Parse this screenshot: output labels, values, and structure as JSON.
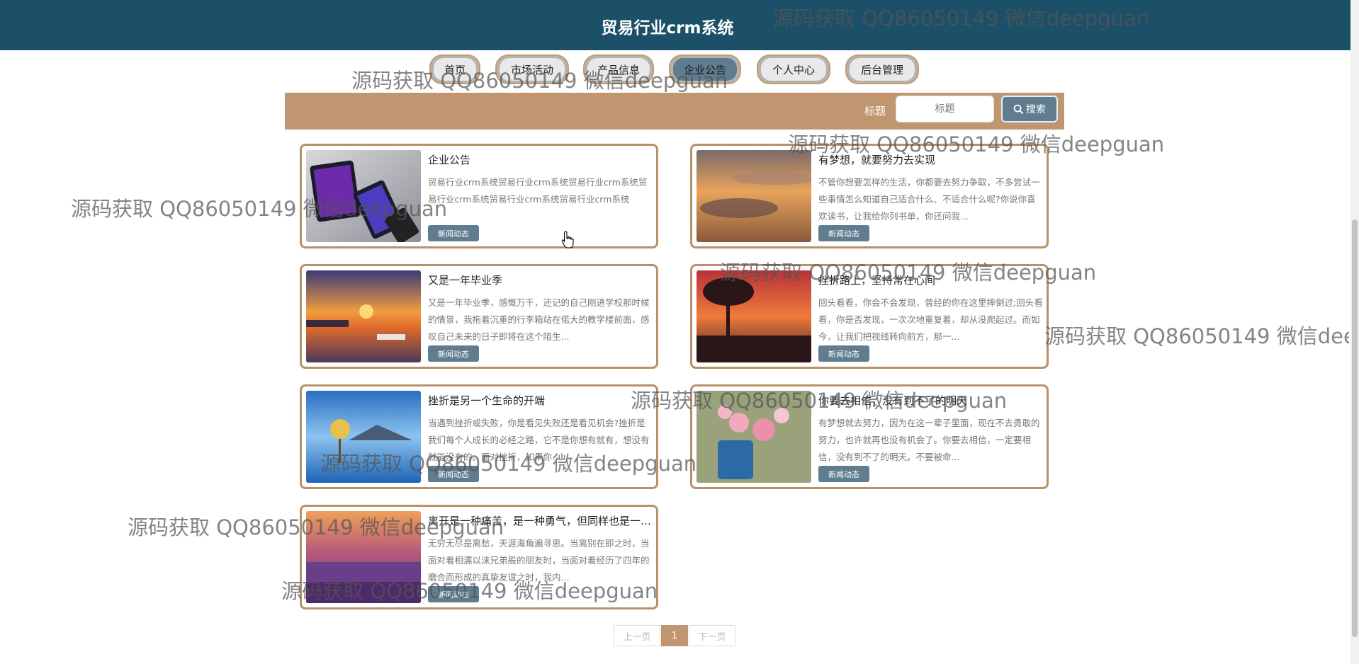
{
  "header": {
    "title": "贸易行业crm系统"
  },
  "nav": {
    "items": [
      {
        "label": "首页",
        "active": false
      },
      {
        "label": "市场活动",
        "active": false
      },
      {
        "label": "产品信息",
        "active": false
      },
      {
        "label": "企业公告",
        "active": true
      },
      {
        "label": "个人中心",
        "active": false
      },
      {
        "label": "后台管理",
        "active": false
      }
    ]
  },
  "search": {
    "label": "标题",
    "placeholder": "标题",
    "button_label": "搜索",
    "button_icon": "search-icon"
  },
  "cards": [
    {
      "title": "企业公告",
      "desc": "贸易行业crm系统贸易行业crm系统贸易行业crm系统贸易行业crm系统贸易行业crm系统贸易行业crm系统",
      "tag": "新闻动态"
    },
    {
      "title": "有梦想，就要努力去实现",
      "desc": "不管你想要怎样的生活，你都要去努力争取，不多尝试一些事情怎么知道自己适合什么、不适合什么呢?你说你喜欢读书，让我给你列书单，你还问我...",
      "tag": "新闻动态"
    },
    {
      "title": "又是一年毕业季",
      "desc": "又是一年毕业季，感慨万千，还记的自己刚进学校那时候的情景，我拖着沉重的行李箱站在偌大的教学楼前面，感叹自己未来的日子即将在这个陌生...",
      "tag": "新闻动态"
    },
    {
      "title": "挫折路上，坚持常在心间",
      "desc": "回头看看，你会不会发现，曾经的你在这里摔倒过;回头看看，你是否发现，一次次地重复着，却从没爬起过。而如今，让我们把视线转向前方，那一...",
      "tag": "新闻动态"
    },
    {
      "title": "挫折是另一个生命的开端",
      "desc": "当遇到挫折或失败，你是看见失败还是看见机会?挫折是我们每个人成长的必经之路，它不是你想有就有，想没有就能没有的。面对挫折，如果你...",
      "tag": "新闻动态"
    },
    {
      "title": "你要去相信，没有到不了的明天",
      "desc": "有梦想就去努力，因为在这一辈子里面，现在不去勇敢的努力，也许就再也没有机会了。你要去相信，一定要相信，没有到不了的明天。不要被命...",
      "tag": "新闻动态"
    },
    {
      "title": "离开是一种痛苦，是一种勇气，但同样也是一种希望",
      "desc": "无穷无尽是离愁，天涯海角遍寻思。当离别在即之时，当面对着相濡以沫兄弟般的朋友时，当面对着经历了四年的磨合而形成的真挚友谊之时，我内...",
      "tag": "新闻动态"
    }
  ],
  "pagination": {
    "prev": "上一页",
    "current": "1",
    "next": "下一页"
  },
  "watermark": {
    "text": "源码获取 QQ86050149 微信deepguan"
  },
  "colors": {
    "header_bg": "#1c5068",
    "accent": "#c09671",
    "button": "#5f7d8f"
  }
}
